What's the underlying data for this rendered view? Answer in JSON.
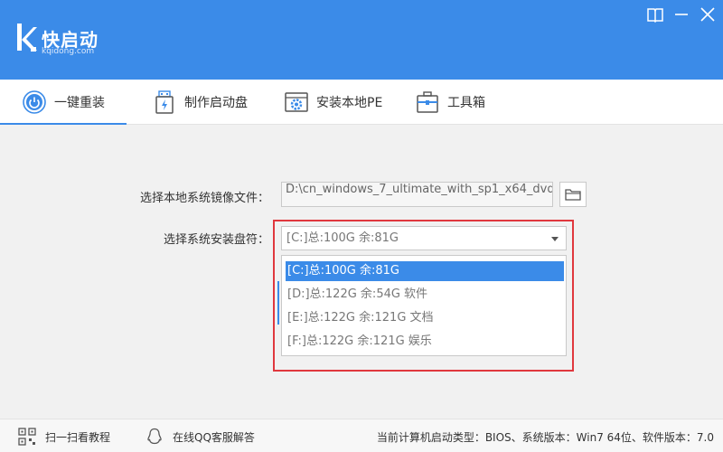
{
  "app": {
    "title": "快启动",
    "subtitle": "kqidong.com",
    "brand_color": "#3b8be8"
  },
  "window_controls": [
    {
      "name": "skin-icon"
    },
    {
      "name": "minimize-icon"
    },
    {
      "name": "close-icon"
    }
  ],
  "tabs": [
    {
      "label": "一键重装",
      "icon": "power-icon",
      "active": true
    },
    {
      "label": "制作启动盘",
      "icon": "usb-drive-icon",
      "active": false
    },
    {
      "label": "安装本地PE",
      "icon": "pe-gear-icon",
      "active": false
    },
    {
      "label": "工具箱",
      "icon": "toolbox-icon",
      "active": false
    }
  ],
  "form": {
    "image_label": "选择本地系统镜像文件：",
    "image_path": "D:\\cn_windows_7_ultimate_with_sp1_x64_dvd",
    "drive_label": "选择系统安装盘符：",
    "drive_selected": "[C:]总:100G 余:81G",
    "drive_options": [
      "[C:]总:100G 余:81G",
      "[D:]总:122G 余:54G 软件",
      "[E:]总:122G 余:121G 文档",
      "[F:]总:122G 余:121G 娱乐"
    ],
    "highlight_color": "#e0383e"
  },
  "footer": {
    "scan_label": "扫一扫看教程",
    "qq_label": "在线QQ客服解答",
    "info": "当前计算机启动类型：BIOS、系统版本：Win7 64位、软件版本：7.0"
  }
}
